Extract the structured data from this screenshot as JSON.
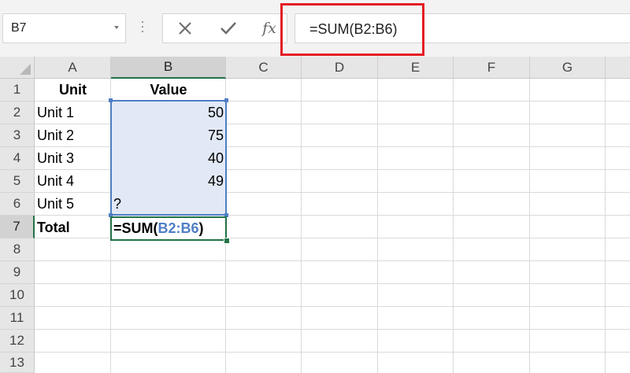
{
  "name_box": {
    "value": "B7"
  },
  "formula_bar": {
    "cancel_icon": "close-icon",
    "enter_icon": "checkmark-icon",
    "function_label": "fx",
    "formula": "=SUM(B2:B6)"
  },
  "columns": [
    "A",
    "B",
    "C",
    "D",
    "E",
    "F",
    "G"
  ],
  "selected_column": "B",
  "rows": [
    "1",
    "2",
    "3",
    "4",
    "5",
    "6",
    "7",
    "8",
    "9",
    "10",
    "11",
    "12",
    "13"
  ],
  "selected_row": "7",
  "cells": {
    "A1": "Unit",
    "B1": "Value",
    "A2": "Unit 1",
    "B2": "50",
    "A3": "Unit 2",
    "B3": "75",
    "A4": "Unit 3",
    "B4": "40",
    "A5": "Unit 4",
    "B5": "49",
    "A6": "Unit 5",
    "B6": "?",
    "A7": "Total"
  },
  "editing": {
    "prefix": "=SUM(",
    "range_ref": "B2:B6",
    "suffix": ")"
  },
  "colors": {
    "highlight_box": "#e31d24",
    "reference_range": "#4f7ec3",
    "range_fill": "#e1e9f6",
    "active_border": "#217346"
  }
}
